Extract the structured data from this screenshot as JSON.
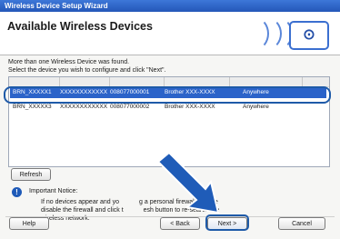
{
  "window": {
    "title": "Wireless Device Setup Wizard"
  },
  "header": {
    "title": "Available Wireless Devices"
  },
  "instructions": {
    "line1": "More than one Wireless Device was found.",
    "line2": "Select the device you wish to configure and click \"Next\"."
  },
  "devices": [
    {
      "name": "BRN_XXXXX1",
      "ip": "XXXXXXXXXXXX",
      "mac": "008077000001",
      "model": "Brother XXX-XXXX",
      "location": "Anywhere",
      "selected": true
    },
    {
      "name": "BRN_XXXXX3",
      "ip": "XXXXXXXXXXXX",
      "mac": "008077000002",
      "model": "Brother XXX-XXXX",
      "location": "Anywhere",
      "selected": false
    }
  ],
  "buttons": {
    "refresh": "Refresh",
    "help": "Help",
    "back": "< Back",
    "next": "Next >",
    "cancel": "Cancel"
  },
  "notice": {
    "title": "Important Notice:",
    "line1": "If no devices appear and yo",
    "line1b": "g a personal firewall, please",
    "line2": "disable the firewall and click t",
    "line2b": "esh button to re-search the",
    "line3": "wireless network."
  },
  "colors": {
    "accent": "#1e5aa8",
    "selection": "#2b63c9",
    "titlebar": "#2f63c8"
  }
}
